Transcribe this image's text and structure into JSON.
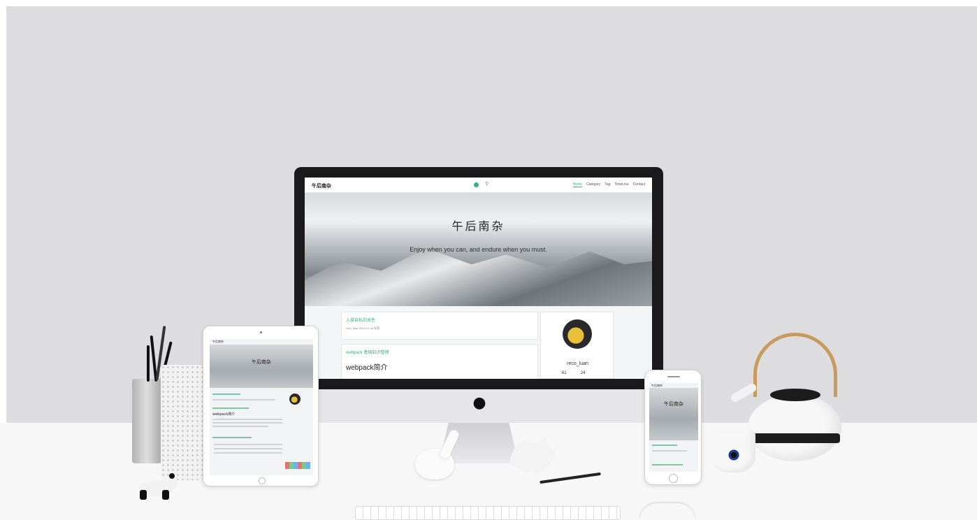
{
  "site": {
    "brand": "午后南杂",
    "nav_links": [
      "Home",
      "Category",
      "Tag",
      "TimeLine",
      "Contact"
    ],
    "hero_logo": "午后南杂",
    "motto": "Enjoy when you can, and endure when you must."
  },
  "posts": [
    {
      "title": "入侵自私的本性",
      "meta": "reco_luan  2019-12-16  标签"
    },
    {
      "title": "webpack 基础知识整理",
      "heading": "webpack简介"
    }
  ],
  "profile": {
    "name": "reco_luan",
    "stats": [
      "61",
      "24"
    ]
  },
  "ipad": {
    "brand": "午后南杂",
    "hero_logo": "午后南杂",
    "heading": "webpack简介"
  },
  "iphone": {
    "brand": "午后南杂",
    "hero_logo": "午后南杂"
  },
  "colors": {
    "accent": "#3eaf7c",
    "wall": "#dddde0",
    "teapot_handle": "#c79a5e"
  }
}
